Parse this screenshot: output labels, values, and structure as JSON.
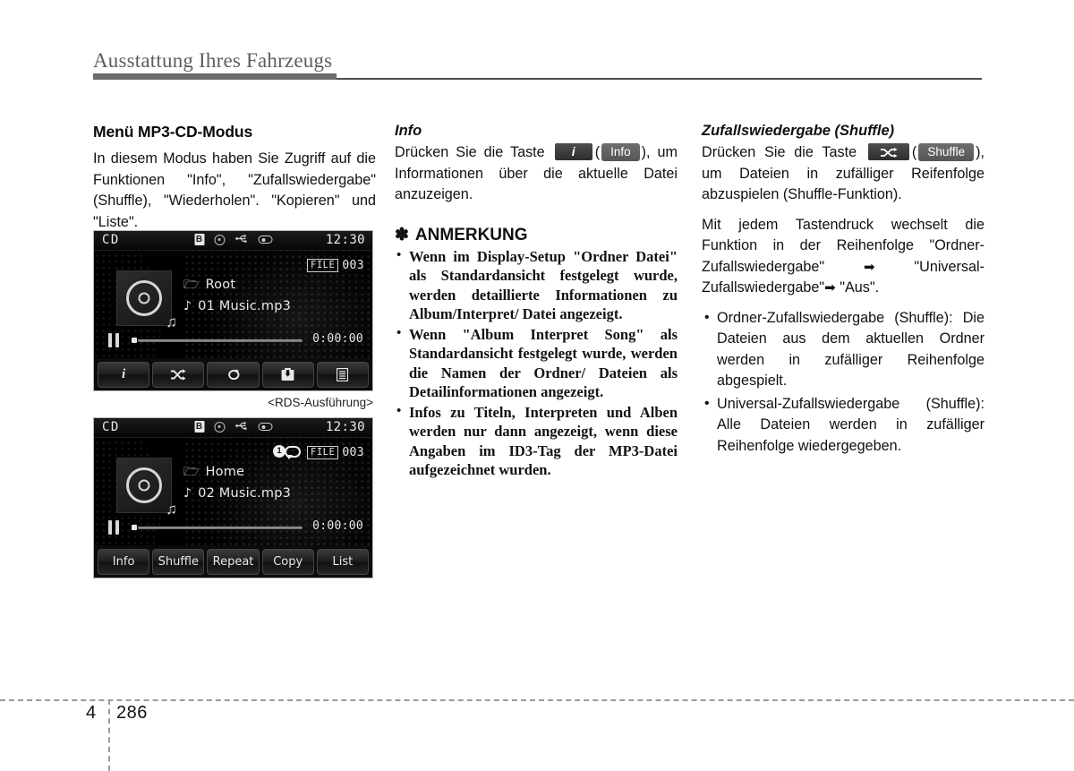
{
  "header": {
    "chapter_title": "Ausstattung Ihres Fahrzeugs"
  },
  "footer": {
    "chapter_number": "4",
    "page_number": "286"
  },
  "column_left": {
    "heading": "Menü MP3-CD-Modus",
    "paragraph": "In diesem Modus haben Sie Zugriff auf die Funktionen \"Info\", \"Zufallswiedergabe\" (Shuffle), \"Wiederholen\". \"Kopieren\" und \"Liste\".",
    "caption": "<RDS-Ausführung>"
  },
  "column_middle": {
    "heading": "Info",
    "sentence_before_key": "Drücken Sie die Taste",
    "key_icon_label": "i",
    "paren_open": "(",
    "key_text_label": "Info",
    "paren_close": "),",
    "sentence_after_key": "um Informationen über die aktuelle Datei anzuzeigen.",
    "note": {
      "star": "✽",
      "title": "ANMERKUNG",
      "items": [
        "Wenn im Display-Setup \"Ordner Datei\" als Standardansicht festgelegt wurde, werden detaillierte Informationen zu Album/Interpret/ Datei angezeigt.",
        "Wenn \"Album Interpret Song\" als Standardansicht festgelegt wurde, werden die Namen der Ordner/ Dateien als Detailinformationen angezeigt.",
        "Infos zu Titeln, Interpreten und Alben werden nur dann angezeigt, wenn diese Angaben im ID3-Tag der MP3-Datei aufgezeichnet wurden."
      ]
    }
  },
  "column_right": {
    "heading": "Zufallswiedergabe (Shuffle)",
    "sentence_before_key": "Drücken Sie die Taste",
    "key_icon_label": "shuffle-glyph",
    "paren_open": "(",
    "key_text_label": "Shuffle",
    "paren_close": "),",
    "sentence_after_key": "um Dateien in zufälliger Reifenfolge abzuspielen (Shuffle-Funktion).",
    "paragraph_2_part1": "Mit jedem Tastendruck wechselt die Funktion in der Reihenfolge \"Ordner-Zufallswiedergabe\"",
    "arrow_1": "➡",
    "paragraph_2_part2": "\"Universal-Zufallswiedergabe\"",
    "arrow_2": "➡",
    "paragraph_2_part3": "\"Aus\".",
    "bullets": [
      "Ordner-Zufallswiedergabe (Shuffle): Die Dateien aus dem aktuellen Ordner werden in zufälliger Reihenfolge abgespielt.",
      "Universal-Zufallswiedergabe (Shuffle): Alle Dateien werden in zufälliger Reihenfolge wiedergegeben."
    ]
  },
  "screens": [
    {
      "id": "screen-icon-buttons",
      "status": {
        "source": "CD",
        "clock": "12:30",
        "icons": [
          "bluetooth-icon",
          "disc-icon",
          "usb-icon",
          "device-icon"
        ],
        "bluetooth_glyph": "B"
      },
      "file_tag": "FILE",
      "file_number": "003",
      "repeat_badge": null,
      "folder": "Root",
      "track": "01 Music.mp3",
      "time": "0:00:00",
      "buttons": [
        {
          "name": "info",
          "glyph": "i",
          "label": ""
        },
        {
          "name": "shuffle",
          "glyph": "shuffle-icon",
          "label": ""
        },
        {
          "name": "repeat",
          "glyph": "repeat-icon",
          "label": ""
        },
        {
          "name": "copy",
          "glyph": "copy-icon",
          "label": ""
        },
        {
          "name": "list",
          "glyph": "list-icon",
          "label": ""
        }
      ]
    },
    {
      "id": "screen-text-buttons",
      "status": {
        "source": "CD",
        "clock": "12:30",
        "icons": [
          "bluetooth-icon",
          "disc-icon",
          "usb-icon",
          "device-icon"
        ],
        "bluetooth_glyph": "B"
      },
      "file_tag": "FILE",
      "file_number": "003",
      "repeat_badge": {
        "digit": "1",
        "icon": "repeat-one-icon"
      },
      "folder": "Home",
      "track": "02 Music.mp3",
      "time": "0:00:00",
      "buttons": [
        {
          "name": "info",
          "glyph": "",
          "label": "Info"
        },
        {
          "name": "shuffle",
          "glyph": "",
          "label": "Shuffle"
        },
        {
          "name": "repeat",
          "glyph": "",
          "label": "Repeat"
        },
        {
          "name": "copy",
          "glyph": "",
          "label": "Copy"
        },
        {
          "name": "list",
          "glyph": "",
          "label": "List"
        }
      ]
    }
  ],
  "colors": {
    "rule": "#6b6b6b",
    "title": "#5d5d5d",
    "text": "#111111",
    "screen_bg": "#000000"
  }
}
